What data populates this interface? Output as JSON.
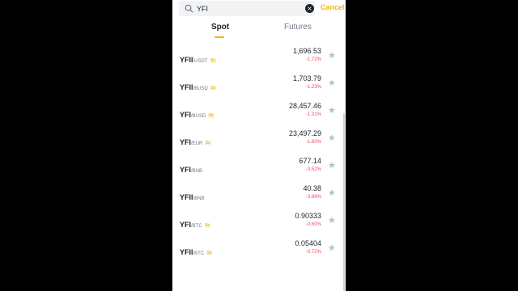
{
  "search": {
    "value": "YFI",
    "clear_icon": "clear-icon",
    "cancel_label": "Cancel"
  },
  "tabs": [
    {
      "label": "Spot",
      "active": true
    },
    {
      "label": "Futures",
      "active": false
    }
  ],
  "colors": {
    "accent": "#f0b90b",
    "negative": "#f6465d",
    "text": "#1e2329",
    "muted": "#707a8a"
  },
  "rows": [
    {
      "base": "YFII",
      "quote": "/USDT",
      "leverage": "5x",
      "price": "1,696.53",
      "change": "-1.72%"
    },
    {
      "base": "YFII",
      "quote": "/BUSD",
      "leverage": "5x",
      "price": "1,703.79",
      "change": "-1.23%"
    },
    {
      "base": "YFI",
      "quote": "/BUSD",
      "leverage": "5x",
      "price": "28,457.46",
      "change": "-1.31%"
    },
    {
      "base": "YFI",
      "quote": "/EUR",
      "leverage": "5x",
      "price": "23,497.29",
      "change": "-1.60%"
    },
    {
      "base": "YFI",
      "quote": "/BNB",
      "leverage": "",
      "price": "677.14",
      "change": "-3.52%"
    },
    {
      "base": "YFII",
      "quote": "/BNB",
      "leverage": "",
      "price": "40.38",
      "change": "-3.86%"
    },
    {
      "base": "YFI",
      "quote": "/BTC",
      "leverage": "5x",
      "price": "0.90333",
      "change": "-0.60%"
    },
    {
      "base": "YFII",
      "quote": "/BTC",
      "leverage": "5x",
      "price": "0.05404",
      "change": "-0.72%"
    }
  ]
}
